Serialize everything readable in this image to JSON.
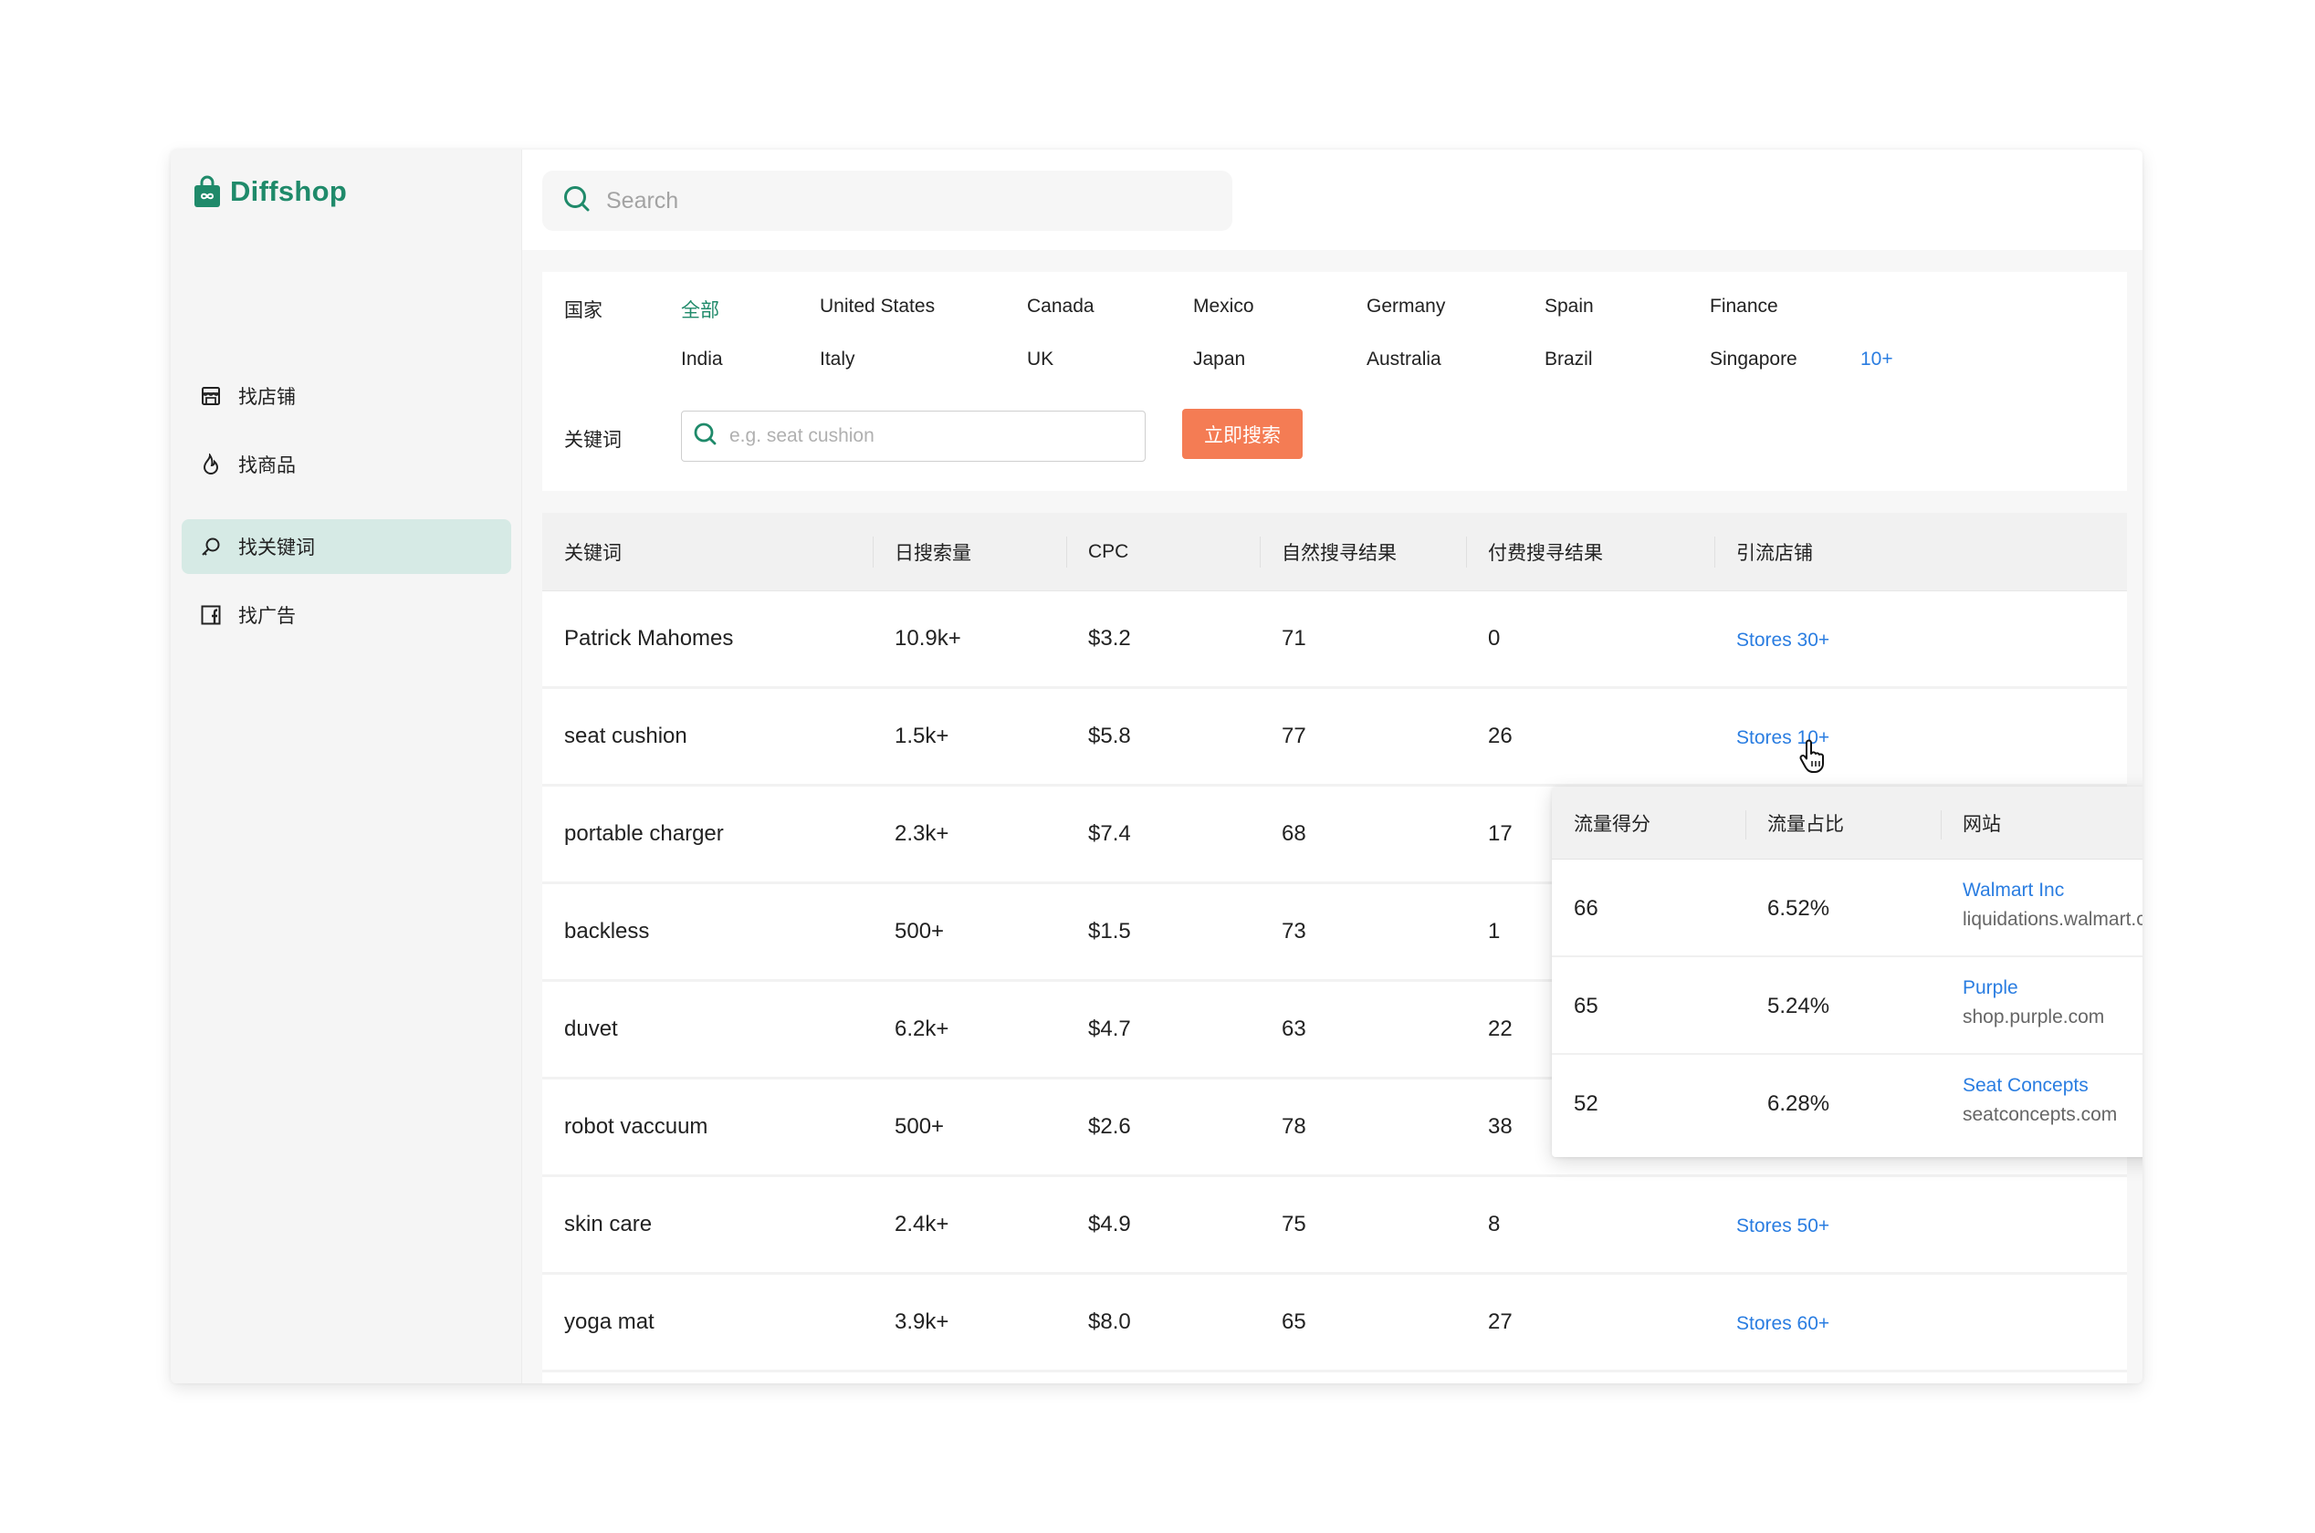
{
  "app": {
    "name": "Diffshop",
    "brand_color": "#1f8a6a",
    "accent_button_color": "#f47c54",
    "link_color": "#2a7de1"
  },
  "sidebar": {
    "items": [
      {
        "label": "找店铺",
        "icon": "store-icon",
        "active": false
      },
      {
        "label": "找商品",
        "icon": "flame-icon",
        "active": false
      },
      {
        "label": "找关键词",
        "icon": "key-search-icon",
        "active": true
      },
      {
        "label": "找广告",
        "icon": "facebook-icon",
        "active": false
      }
    ]
  },
  "topbar": {
    "search_placeholder": "Search"
  },
  "filters": {
    "country_label": "国家",
    "countries_row1": [
      "全部",
      "United States",
      "Canada",
      "Mexico",
      "Germany",
      "Spain",
      "Finance"
    ],
    "countries_row2": [
      "India",
      "Italy",
      "UK",
      "Japan",
      "Australia",
      "Brazil",
      "Singapore"
    ],
    "more_label": "10+",
    "active_country": "全部",
    "keyword_label": "关键词",
    "keyword_placeholder": "e.g. seat cushion",
    "keyword_value": "",
    "search_button": "立即搜索"
  },
  "table": {
    "columns": [
      "关键词",
      "日搜索量",
      "CPC",
      "自然搜寻结果",
      "付费搜寻结果",
      "引流店铺"
    ],
    "rows": [
      {
        "keyword": "Patrick Mahomes",
        "daily_searches": "10.9k+",
        "cpc": "$3.2",
        "organic": "71",
        "paid": "0",
        "stores": "Stores 30+"
      },
      {
        "keyword": "seat cushion",
        "daily_searches": "1.5k+",
        "cpc": "$5.8",
        "organic": "77",
        "paid": "26",
        "stores": "Stores 10+"
      },
      {
        "keyword": "portable charger",
        "daily_searches": "2.3k+",
        "cpc": "$7.4",
        "organic": "68",
        "paid": "17",
        "stores": ""
      },
      {
        "keyword": "backless",
        "daily_searches": "500+",
        "cpc": "$1.5",
        "organic": "73",
        "paid": "1",
        "stores": ""
      },
      {
        "keyword": "duvet",
        "daily_searches": "6.2k+",
        "cpc": "$4.7",
        "organic": "63",
        "paid": "22",
        "stores": ""
      },
      {
        "keyword": "robot vaccuum",
        "daily_searches": "500+",
        "cpc": "$2.6",
        "organic": "78",
        "paid": "38",
        "stores": ""
      },
      {
        "keyword": "skin care",
        "daily_searches": "2.4k+",
        "cpc": "$4.9",
        "organic": "75",
        "paid": "8",
        "stores": "Stores 50+"
      },
      {
        "keyword": "yoga mat",
        "daily_searches": "3.9k+",
        "cpc": "$8.0",
        "organic": "65",
        "paid": "27",
        "stores": "Stores 60+"
      }
    ]
  },
  "popover": {
    "columns": [
      "流量得分",
      "流量占比",
      "网站"
    ],
    "rows": [
      {
        "score": "66",
        "share": "6.52%",
        "name": "Walmart Inc",
        "domain": "liquidations.walmart.com"
      },
      {
        "score": "65",
        "share": "5.24%",
        "name": "Purple",
        "domain": "shop.purple.com"
      },
      {
        "score": "52",
        "share": "6.28%",
        "name": "Seat Concepts",
        "domain": "seatconcepts.com"
      }
    ]
  }
}
